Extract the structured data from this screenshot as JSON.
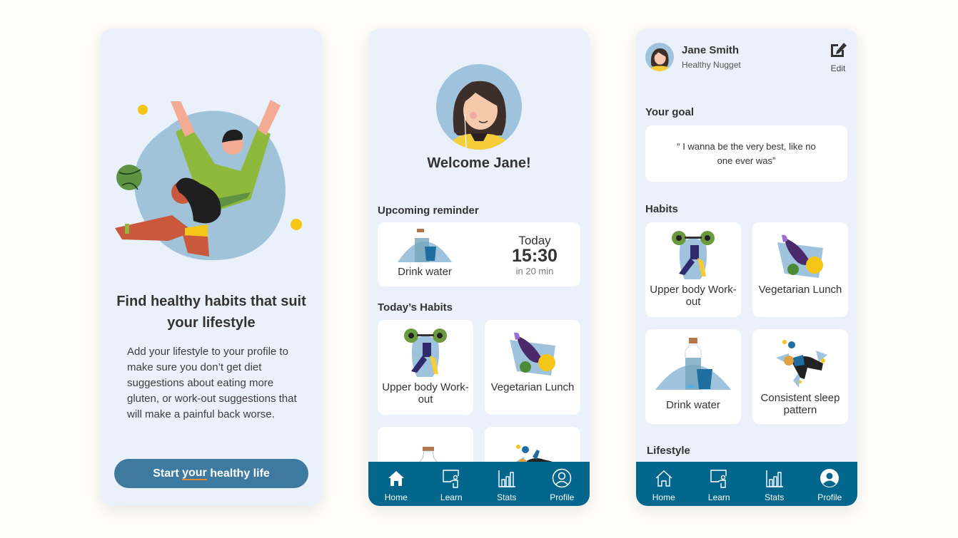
{
  "onboarding": {
    "title": "Find healthy habits that suit your lifestyle",
    "body": "Add your lifestyle to your profile to make sure you don’t get diet suggestions about eating more gluten, or work-out suggestions that will make a painful back worse.",
    "cta": {
      "before": "Start ",
      "underlined": "your",
      "after": " healthy life"
    }
  },
  "home": {
    "welcome": "Welcome Jane!",
    "reminder_heading": "Upcoming reminder",
    "reminder": {
      "label": "Drink water",
      "day": "Today",
      "time": "15:30",
      "relative": "in 20 min"
    },
    "habits_heading": "Today’s Habits",
    "habits": [
      {
        "label": "Upper body Work-out",
        "icon": "weightlifter-icon"
      },
      {
        "label": "Vegetarian Lunch",
        "icon": "vegetables-icon"
      },
      {
        "label": "",
        "icon": "water-bottle-icon"
      },
      {
        "label": "",
        "icon": "sleep-person-icon"
      }
    ]
  },
  "profile": {
    "name": "Jane Smith",
    "subtitle": "Healthy Nugget",
    "edit_label": "Edit",
    "goal_heading": "Your goal",
    "goal": "“ I wanna be the very best, like no one ever was”",
    "habits_heading": "Habits",
    "habits": [
      {
        "label": "Upper body Work-out",
        "icon": "weightlifter-icon"
      },
      {
        "label": "Vegetarian Lunch",
        "icon": "vegetables-icon"
      },
      {
        "label": "Drink water",
        "icon": "water-bottle-icon"
      },
      {
        "label": "Consistent sleep pattern",
        "icon": "sleep-person-icon"
      }
    ],
    "lifestyle_heading": "Lifestyle"
  },
  "nav": {
    "items": [
      {
        "label": "Home",
        "icon": "home-icon"
      },
      {
        "label": "Learn",
        "icon": "learn-icon"
      },
      {
        "label": "Stats",
        "icon": "stats-icon"
      },
      {
        "label": "Profile",
        "icon": "profile-icon"
      }
    ]
  },
  "colors": {
    "screen_bg": "#eaf1fa",
    "nav_bg": "#03678d",
    "cta_bg": "#3e7aa0",
    "accent_underline": "#e08a3c",
    "illustration_blue": "#9fc3dc"
  }
}
